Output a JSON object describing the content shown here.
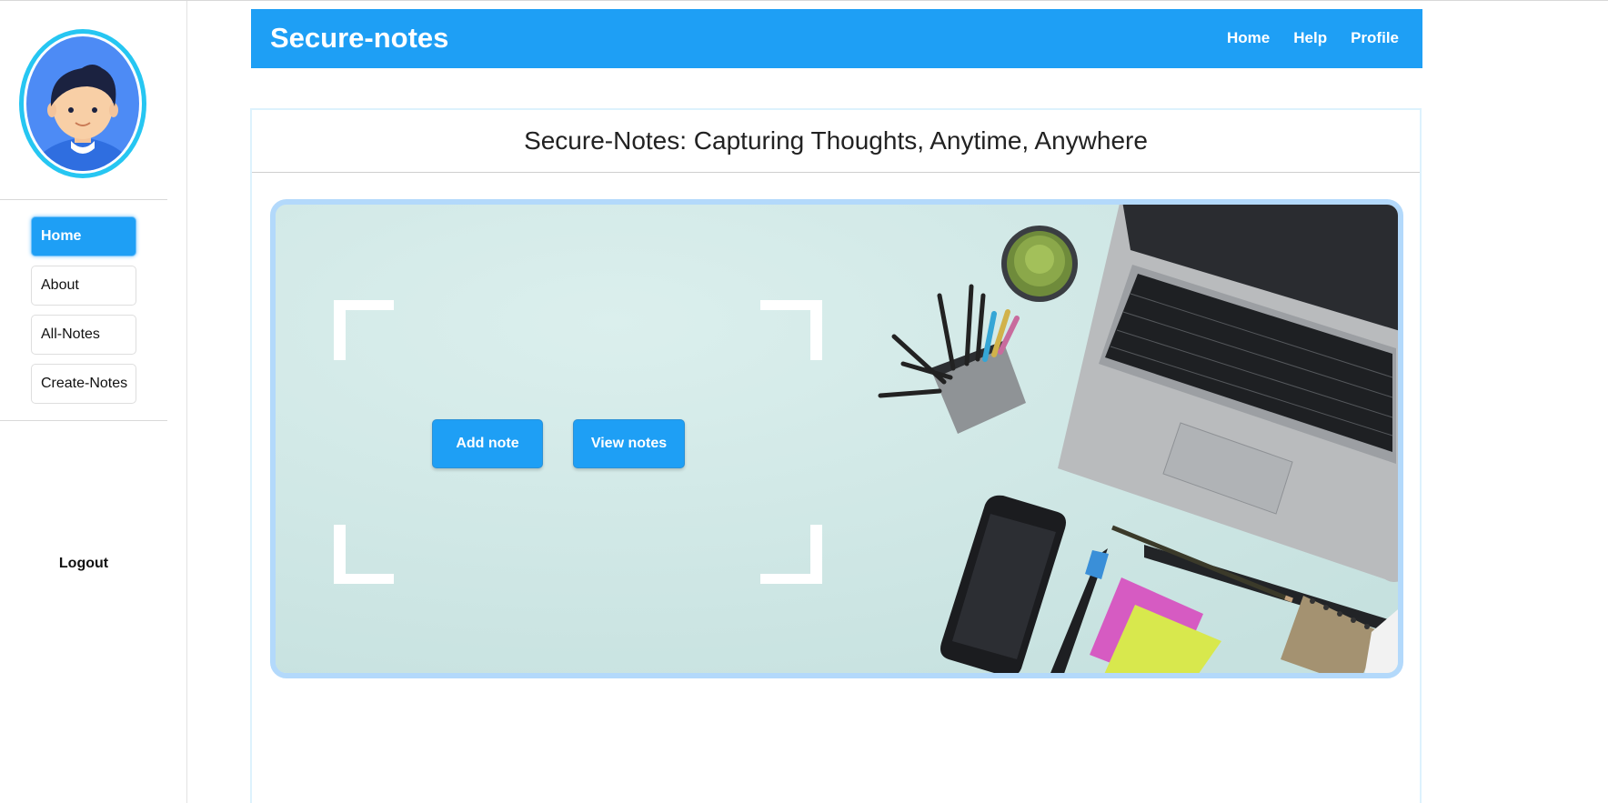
{
  "app": {
    "title": "Secure-notes"
  },
  "header": {
    "nav": [
      "Home",
      "Help",
      "Profile"
    ]
  },
  "sidebar": {
    "items": [
      {
        "label": "Home",
        "active": true
      },
      {
        "label": "About",
        "active": false
      },
      {
        "label": "All-Notes",
        "active": false
      },
      {
        "label": "Create-Notes",
        "active": false
      }
    ],
    "logout_label": "Logout"
  },
  "main": {
    "title": "Secure-Notes: Capturing Thoughts, Anytime, Anywhere",
    "add_note_label": "Add note",
    "view_notes_label": "View notes"
  },
  "colors": {
    "accent": "#1e9ff5",
    "hero_bg": "#d3e9e7"
  }
}
